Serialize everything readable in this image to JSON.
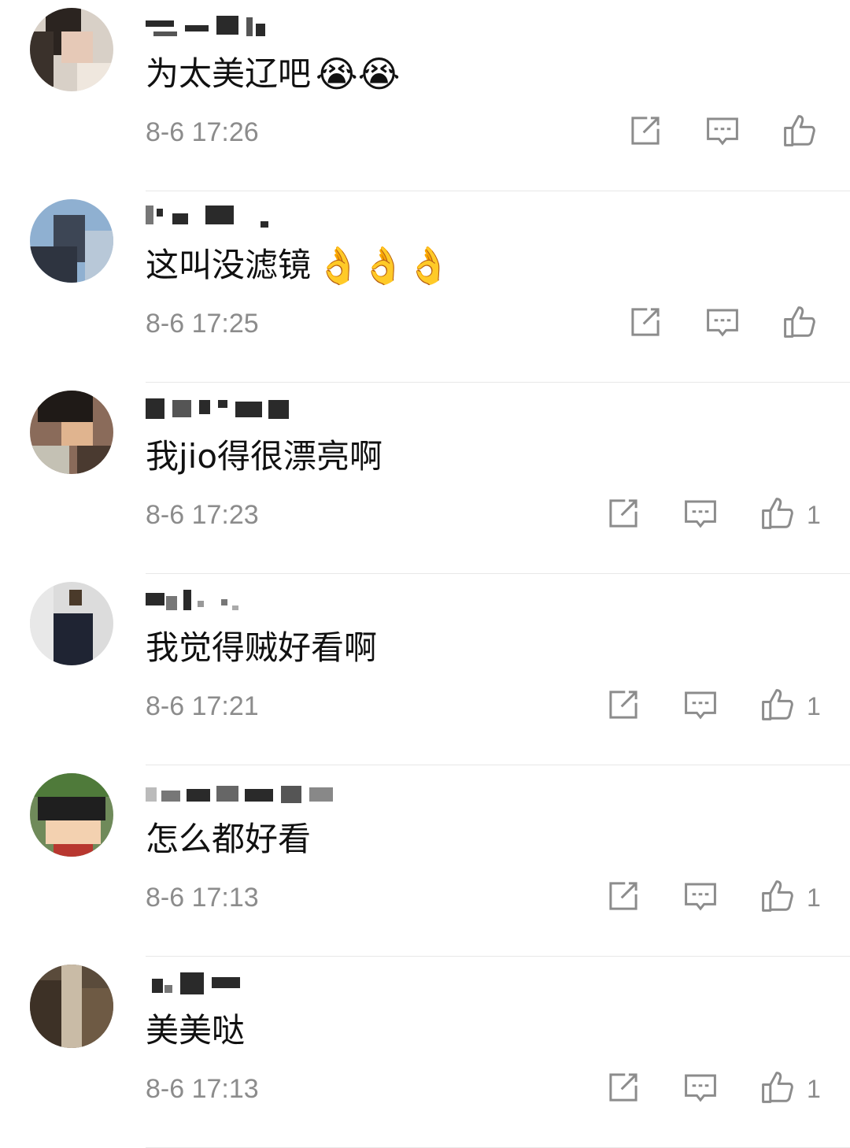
{
  "comments": [
    {
      "text": "为太美辽吧",
      "emoji": "😭😭",
      "time": "8-6 17:26",
      "likes": "",
      "avatar_color": "#d8d0c7"
    },
    {
      "text": "这叫没滤镜",
      "emoji": "👌👌👌",
      "time": "8-6 17:25",
      "likes": "",
      "avatar_color": "#8fb0d1"
    },
    {
      "text": "我jio得很漂亮啊",
      "emoji": "",
      "time": "8-6 17:23",
      "likes": "1",
      "avatar_color": "#8a6b5a"
    },
    {
      "text": "我觉得贼好看啊",
      "emoji": "",
      "time": "8-6 17:21",
      "likes": "1",
      "avatar_color": "#bdbdbd"
    },
    {
      "text": "怎么都好看",
      "emoji": "",
      "time": "8-6 17:13",
      "likes": "1",
      "avatar_color": "#6f8a5a"
    },
    {
      "text": "美美哒",
      "emoji": "",
      "time": "8-6 17:13",
      "likes": "1",
      "avatar_color": "#5a4b3b"
    }
  ],
  "icons": {
    "repost": "repost-icon",
    "comment": "comment-icon",
    "like": "thumbs-up-icon"
  },
  "colors": {
    "text": "#111111",
    "meta": "#8c8c8c",
    "divider": "#e8e8e8",
    "icon": "#8c8c8c"
  }
}
